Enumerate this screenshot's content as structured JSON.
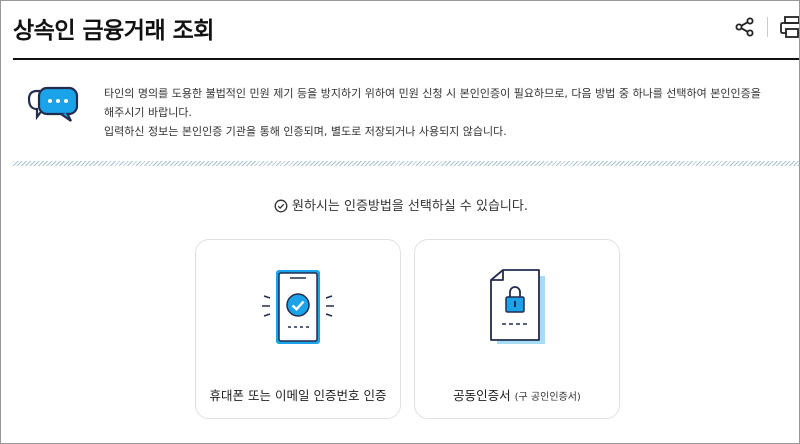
{
  "header": {
    "title": "상속인 금융거래 조회",
    "icons": {
      "share": "share-icon",
      "print": "print-icon"
    }
  },
  "notice": {
    "icon": "chat-bubble-icon",
    "line1": "타인의 명의를 도용한 불법적인 민원 제기 등을 방지하기 위하여 민원 신청 시 본인인증이 필요하므로, 다음 방법 중 하나를 선택하여 본인인증을",
    "line2": "해주시기 바랍니다.",
    "line3": "입력하신 정보는 본인인증 기관을 통해 인증되며, 별도로 저장되거나 사용되지 않습니다."
  },
  "auth": {
    "prompt": "원하시는 인증방법을 선택하실 수 있습니다.",
    "options": [
      {
        "label": "휴대폰 또는 이메일 인증번호 인증",
        "icon": "phone-check-icon"
      },
      {
        "label": "공동인증서",
        "note": "(구 공인인증서)",
        "icon": "certificate-lock-icon"
      }
    ]
  },
  "colors": {
    "accent": "#1aa3e8",
    "dark": "#222c4f",
    "light_blue": "#a6dcf5"
  }
}
